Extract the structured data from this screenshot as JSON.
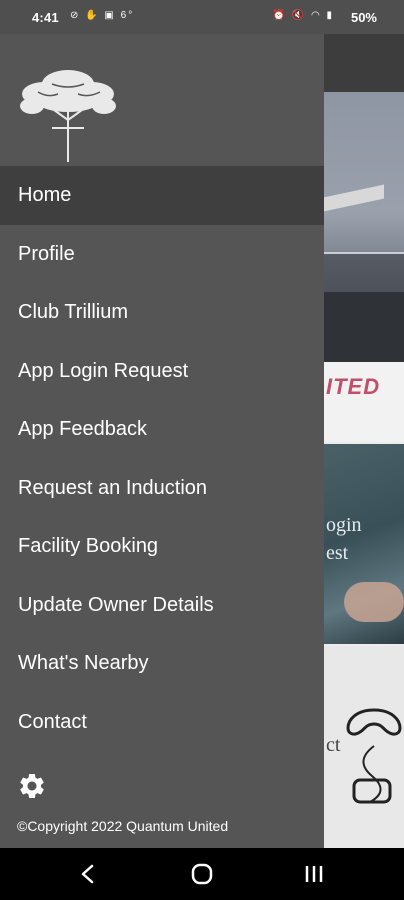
{
  "status_bar": {
    "time": "4:41",
    "battery": "50%",
    "left_icons": [
      "sync-icon",
      "hand-icon",
      "image-icon",
      "temperature-icon"
    ],
    "left_temp": "6°",
    "right_icons": [
      "alarm-icon",
      "mute-icon",
      "wifi-icon",
      "signal-icon",
      "battery-icon"
    ]
  },
  "drawer": {
    "logo": "tree-logo",
    "menu": [
      {
        "label": "Home",
        "active": true
      },
      {
        "label": "Profile"
      },
      {
        "label": "Club Trillium"
      },
      {
        "label": "App Login Request"
      },
      {
        "label": "App Feedback"
      },
      {
        "label": "Request an Induction"
      },
      {
        "label": "Facility Booking"
      },
      {
        "label": "Update Owner Details"
      },
      {
        "label": "What's Nearby"
      },
      {
        "label": "Contact"
      }
    ],
    "settings_icon": "gear-icon",
    "copyright": "©Copyright 2022 Quantum United"
  },
  "background": {
    "tile1_caption": "ITED",
    "tile2_line1": "ogin",
    "tile2_line2": "est",
    "tile3_text": "ct"
  },
  "nav_bar": {
    "back": "back-icon",
    "home": "home-icon",
    "recents": "recents-icon"
  },
  "colors": {
    "drawer_bg": "#555555",
    "active_item_bg": "#3f3f3f",
    "text": "#ffffff",
    "caption_accent": "#c0506a"
  }
}
